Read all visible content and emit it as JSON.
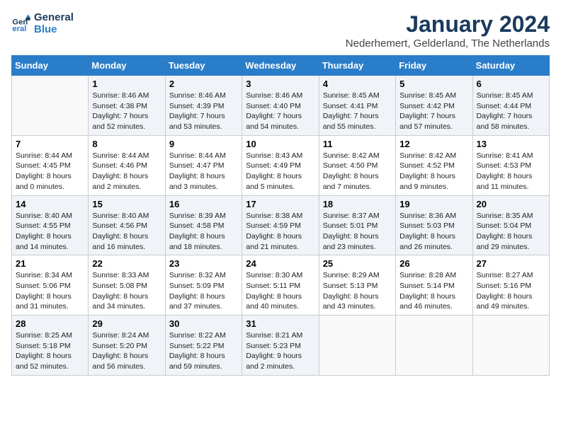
{
  "logo": {
    "line1": "General",
    "line2": "Blue"
  },
  "title": "January 2024",
  "location": "Nederhemert, Gelderland, The Netherlands",
  "days_of_week": [
    "Sunday",
    "Monday",
    "Tuesday",
    "Wednesday",
    "Thursday",
    "Friday",
    "Saturday"
  ],
  "weeks": [
    [
      {
        "day": "",
        "detail": ""
      },
      {
        "day": "1",
        "detail": "Sunrise: 8:46 AM\nSunset: 4:38 PM\nDaylight: 7 hours\nand 52 minutes."
      },
      {
        "day": "2",
        "detail": "Sunrise: 8:46 AM\nSunset: 4:39 PM\nDaylight: 7 hours\nand 53 minutes."
      },
      {
        "day": "3",
        "detail": "Sunrise: 8:46 AM\nSunset: 4:40 PM\nDaylight: 7 hours\nand 54 minutes."
      },
      {
        "day": "4",
        "detail": "Sunrise: 8:45 AM\nSunset: 4:41 PM\nDaylight: 7 hours\nand 55 minutes."
      },
      {
        "day": "5",
        "detail": "Sunrise: 8:45 AM\nSunset: 4:42 PM\nDaylight: 7 hours\nand 57 minutes."
      },
      {
        "day": "6",
        "detail": "Sunrise: 8:45 AM\nSunset: 4:44 PM\nDaylight: 7 hours\nand 58 minutes."
      }
    ],
    [
      {
        "day": "7",
        "detail": "Sunrise: 8:44 AM\nSunset: 4:45 PM\nDaylight: 8 hours\nand 0 minutes."
      },
      {
        "day": "8",
        "detail": "Sunrise: 8:44 AM\nSunset: 4:46 PM\nDaylight: 8 hours\nand 2 minutes."
      },
      {
        "day": "9",
        "detail": "Sunrise: 8:44 AM\nSunset: 4:47 PM\nDaylight: 8 hours\nand 3 minutes."
      },
      {
        "day": "10",
        "detail": "Sunrise: 8:43 AM\nSunset: 4:49 PM\nDaylight: 8 hours\nand 5 minutes."
      },
      {
        "day": "11",
        "detail": "Sunrise: 8:42 AM\nSunset: 4:50 PM\nDaylight: 8 hours\nand 7 minutes."
      },
      {
        "day": "12",
        "detail": "Sunrise: 8:42 AM\nSunset: 4:52 PM\nDaylight: 8 hours\nand 9 minutes."
      },
      {
        "day": "13",
        "detail": "Sunrise: 8:41 AM\nSunset: 4:53 PM\nDaylight: 8 hours\nand 11 minutes."
      }
    ],
    [
      {
        "day": "14",
        "detail": "Sunrise: 8:40 AM\nSunset: 4:55 PM\nDaylight: 8 hours\nand 14 minutes."
      },
      {
        "day": "15",
        "detail": "Sunrise: 8:40 AM\nSunset: 4:56 PM\nDaylight: 8 hours\nand 16 minutes."
      },
      {
        "day": "16",
        "detail": "Sunrise: 8:39 AM\nSunset: 4:58 PM\nDaylight: 8 hours\nand 18 minutes."
      },
      {
        "day": "17",
        "detail": "Sunrise: 8:38 AM\nSunset: 4:59 PM\nDaylight: 8 hours\nand 21 minutes."
      },
      {
        "day": "18",
        "detail": "Sunrise: 8:37 AM\nSunset: 5:01 PM\nDaylight: 8 hours\nand 23 minutes."
      },
      {
        "day": "19",
        "detail": "Sunrise: 8:36 AM\nSunset: 5:03 PM\nDaylight: 8 hours\nand 26 minutes."
      },
      {
        "day": "20",
        "detail": "Sunrise: 8:35 AM\nSunset: 5:04 PM\nDaylight: 8 hours\nand 29 minutes."
      }
    ],
    [
      {
        "day": "21",
        "detail": "Sunrise: 8:34 AM\nSunset: 5:06 PM\nDaylight: 8 hours\nand 31 minutes."
      },
      {
        "day": "22",
        "detail": "Sunrise: 8:33 AM\nSunset: 5:08 PM\nDaylight: 8 hours\nand 34 minutes."
      },
      {
        "day": "23",
        "detail": "Sunrise: 8:32 AM\nSunset: 5:09 PM\nDaylight: 8 hours\nand 37 minutes."
      },
      {
        "day": "24",
        "detail": "Sunrise: 8:30 AM\nSunset: 5:11 PM\nDaylight: 8 hours\nand 40 minutes."
      },
      {
        "day": "25",
        "detail": "Sunrise: 8:29 AM\nSunset: 5:13 PM\nDaylight: 8 hours\nand 43 minutes."
      },
      {
        "day": "26",
        "detail": "Sunrise: 8:28 AM\nSunset: 5:14 PM\nDaylight: 8 hours\nand 46 minutes."
      },
      {
        "day": "27",
        "detail": "Sunrise: 8:27 AM\nSunset: 5:16 PM\nDaylight: 8 hours\nand 49 minutes."
      }
    ],
    [
      {
        "day": "28",
        "detail": "Sunrise: 8:25 AM\nSunset: 5:18 PM\nDaylight: 8 hours\nand 52 minutes."
      },
      {
        "day": "29",
        "detail": "Sunrise: 8:24 AM\nSunset: 5:20 PM\nDaylight: 8 hours\nand 56 minutes."
      },
      {
        "day": "30",
        "detail": "Sunrise: 8:22 AM\nSunset: 5:22 PM\nDaylight: 8 hours\nand 59 minutes."
      },
      {
        "day": "31",
        "detail": "Sunrise: 8:21 AM\nSunset: 5:23 PM\nDaylight: 9 hours\nand 2 minutes."
      },
      {
        "day": "",
        "detail": ""
      },
      {
        "day": "",
        "detail": ""
      },
      {
        "day": "",
        "detail": ""
      }
    ]
  ]
}
